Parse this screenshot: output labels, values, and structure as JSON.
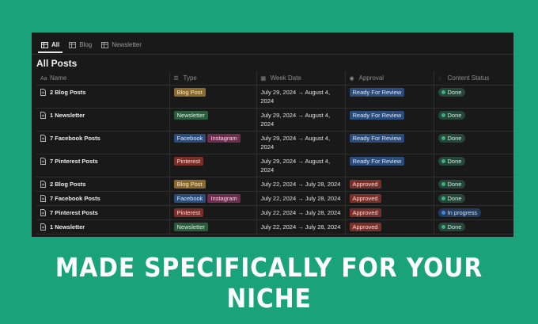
{
  "tabs": [
    {
      "label": "All",
      "icon": "table-icon",
      "active": true
    },
    {
      "label": "Blog",
      "icon": "table-icon",
      "active": false
    },
    {
      "label": "Newsletter",
      "icon": "table-icon",
      "active": false
    }
  ],
  "database_title": "All Posts",
  "columns": {
    "name": "Name",
    "type": "Type",
    "week": "Week Date",
    "approval": "Approval",
    "status": "Content Status"
  },
  "rows": [
    {
      "name": "2 Blog Posts",
      "tags": [
        "Blog Post"
      ],
      "week_line1": "July 29, 2024 → August 4,",
      "week_line2": "2024",
      "approval": "Ready For Review",
      "status": "Done"
    },
    {
      "name": "1 Newsletter",
      "tags": [
        "Newsletter"
      ],
      "week_line1": "July 29, 2024 → August 4,",
      "week_line2": "2024",
      "approval": "Ready For Review",
      "status": "Done"
    },
    {
      "name": "7 Facebook Posts",
      "tags": [
        "Facebook",
        "Instagram"
      ],
      "week_line1": "July 29, 2024 → August 4,",
      "week_line2": "2024",
      "approval": "Ready For Review",
      "status": "Done"
    },
    {
      "name": "7 Pinterest Posts",
      "tags": [
        "Pinterest"
      ],
      "week_line1": "July 29, 2024 → August 4,",
      "week_line2": "2024",
      "approval": "Ready For Review",
      "status": "Done"
    },
    {
      "name": "2 Blog Posts",
      "tags": [
        "Blog Post"
      ],
      "week_line1": "July 22, 2024 → July 28, 2024",
      "week_line2": "",
      "approval": "Approved",
      "status": "Done"
    },
    {
      "name": "7 Facebook Posts",
      "tags": [
        "Facebook",
        "Instagram"
      ],
      "week_line1": "July 22, 2024 → July 28, 2024",
      "week_line2": "",
      "approval": "Approved",
      "status": "Done"
    },
    {
      "name": "7 Pinterest Posts",
      "tags": [
        "Pinterest"
      ],
      "week_line1": "July 22, 2024 → July 28, 2024",
      "week_line2": "",
      "approval": "Approved",
      "status": "In progress"
    },
    {
      "name": "1 Newsletter",
      "tags": [
        "Newsletter"
      ],
      "week_line1": "July 22, 2024 → July 28, 2024",
      "week_line2": "",
      "approval": "Approved",
      "status": "Done"
    }
  ],
  "headline": "MADE SPECIFICALLY FOR YOUR NICHE",
  "colors": {
    "background": "#1aa37a",
    "panel": "#191919",
    "done": "#3fb07d",
    "in_progress": "#3f86e0"
  }
}
